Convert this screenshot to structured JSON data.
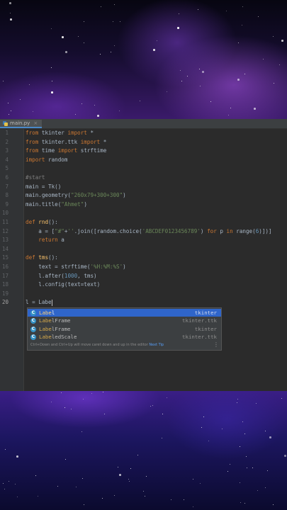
{
  "tab": {
    "filename": "main.py",
    "close": "×"
  },
  "lines": [
    {
      "n": "1",
      "html": "<span class=\"kw\">from</span> tkinter <span class=\"kw\">import</span> *"
    },
    {
      "n": "2",
      "html": "<span class=\"kw\">from</span> tkinter.ttk <span class=\"kw\">import</span> *"
    },
    {
      "n": "3",
      "html": "<span class=\"kw\">from</span> time <span class=\"kw\">import</span> strftime"
    },
    {
      "n": "4",
      "html": "<span class=\"kw\">import</span> random"
    },
    {
      "n": "5",
      "html": ""
    },
    {
      "n": "6",
      "html": "<span class=\"cm\">#start</span>"
    },
    {
      "n": "7",
      "html": "main = Tk()"
    },
    {
      "n": "8",
      "html": "main.geometry(<span class=\"str\">\"260x79+300+300\"</span>)"
    },
    {
      "n": "9",
      "html": "main.title(<span class=\"str\">\"Ahmet\"</span>)"
    },
    {
      "n": "10",
      "html": ""
    },
    {
      "n": "11",
      "html": "<span class=\"kw\">def</span> <span class=\"fn\">rnd</span>():"
    },
    {
      "n": "12",
      "html": "    a = [<span class=\"str\">\"#\"</span>+<span class=\"str\">''</span>.join([random.choice(<span class=\"str\">'ABCDEF0123456789'</span>) <span class=\"kw\">for</span> p <span class=\"kw\">in</span> range(<span class=\"numlit\">6</span>)])]"
    },
    {
      "n": "13",
      "html": "    <span class=\"kw\">return</span> a"
    },
    {
      "n": "14",
      "html": ""
    },
    {
      "n": "15",
      "html": "<span class=\"kw\">def</span> <span class=\"fn\">tms</span>():"
    },
    {
      "n": "16",
      "html": "    text = strftime(<span class=\"str\">'%H:%M:%S'</span>)"
    },
    {
      "n": "17",
      "html": "    l.after(<span class=\"numlit\">1000</span>, tms)"
    },
    {
      "n": "18",
      "html": "    l.config(text=text)"
    },
    {
      "n": "19",
      "html": ""
    },
    {
      "n": "20",
      "html": "l = Labe<span class=\"caret\"></span>"
    }
  ],
  "completion": {
    "items": [
      {
        "match": "Labe",
        "rest": "l",
        "module": "tkinter"
      },
      {
        "match": "Labe",
        "rest": "lFrame",
        "module": "tkinter.ttk"
      },
      {
        "match": "Labe",
        "rest": "lFrame",
        "module": "tkinter"
      },
      {
        "match": "Labe",
        "rest": "ledScale",
        "module": "tkinter.ttk"
      }
    ],
    "icon_letter": "C",
    "hint_text": "Ctrl+Down and Ctrl+Up will move caret down and up in the editor",
    "hint_link": "Next Tip",
    "menu_glyph": "⋮"
  }
}
